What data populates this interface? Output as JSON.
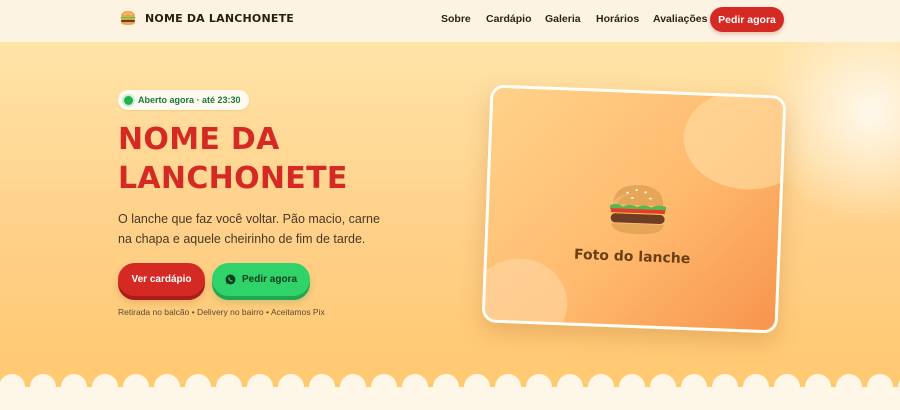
{
  "brand": {
    "name": "NOME DA LANCHONETE",
    "icon": "burger-icon"
  },
  "nav": {
    "links": [
      "Sobre",
      "Cardápio",
      "Galeria",
      "Horários",
      "Avaliações"
    ],
    "cta_label": "Pedir agora"
  },
  "hero": {
    "status": "Aberto agora · até 23:30",
    "title_line1": "NOME DA",
    "title_line2": "LANCHONETE",
    "subtitle": "O lanche que faz você voltar. Pão macio, carne na chapa e aquele cheirinho de fim de tarde.",
    "primary_button": "Ver cardápio",
    "secondary_button": "Pedir agora",
    "secondary_icon": "whatsapp-icon",
    "info": "Retirada no balcão • Delivery no bairro • Aceitamos Pix"
  },
  "photo": {
    "label": "Foto do lanche",
    "icon": "burger-icon"
  },
  "colors": {
    "accent_red": "#d42a23",
    "whatsapp_green": "#2fd36a",
    "status_green": "#22b24c",
    "hero_bg": "#ffd089",
    "page_bg": "#fef6e7"
  }
}
